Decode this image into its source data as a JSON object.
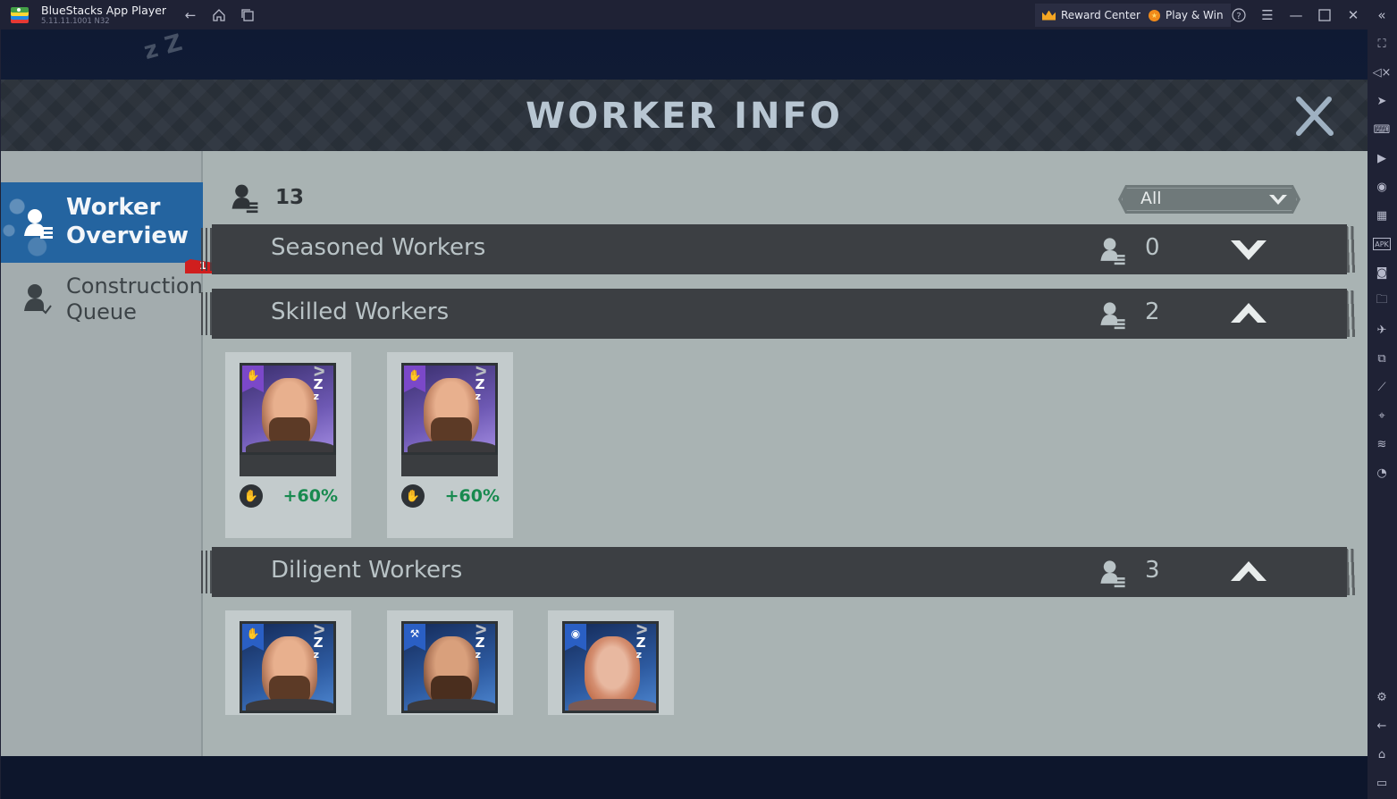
{
  "window": {
    "app_name": "BlueStacks App Player",
    "version": "5.11.11.1001 N32",
    "nav_icons": [
      "back-icon",
      "home-icon",
      "recent-apps-icon"
    ],
    "reward_center_label": "Reward Center",
    "play_win_label": "Play & Win",
    "controls": [
      "help-icon",
      "menu-icon",
      "minimize-icon",
      "maximize-icon",
      "close-icon",
      "collapse-sidebar-icon"
    ]
  },
  "right_sidebar": {
    "items": [
      {
        "name": "fullscreen",
        "glyph": "⛶"
      },
      {
        "name": "volume-mute",
        "glyph": "🔇"
      },
      {
        "name": "pointer",
        "glyph": "➤"
      },
      {
        "name": "keyboard",
        "glyph": "⌨"
      },
      {
        "name": "macro-play",
        "glyph": "▶"
      },
      {
        "name": "rotate-sync",
        "glyph": "◉"
      },
      {
        "name": "game-controls",
        "glyph": "▦"
      },
      {
        "name": "apk-install",
        "glyph": "APK"
      },
      {
        "name": "screenshot",
        "glyph": "◙"
      },
      {
        "name": "folder",
        "glyph": "🗀"
      },
      {
        "name": "airplane-mode",
        "glyph": "✈"
      },
      {
        "name": "multi-instance",
        "glyph": "⧉"
      },
      {
        "name": "shake",
        "glyph": "⟋"
      },
      {
        "name": "location",
        "glyph": "⌖"
      },
      {
        "name": "layers",
        "glyph": "≋"
      },
      {
        "name": "eco-mode",
        "glyph": "◔"
      }
    ],
    "bottom_items": [
      {
        "name": "settings",
        "glyph": "⚙"
      },
      {
        "name": "back",
        "glyph": "←"
      },
      {
        "name": "home",
        "glyph": "⌂"
      },
      {
        "name": "recent-apps",
        "glyph": "▭"
      }
    ]
  },
  "game": {
    "title": "WORKER INFO",
    "tabs": [
      {
        "label_line1": "Worker",
        "label_line2": "Overview",
        "active": true
      },
      {
        "label_line1": "Construction",
        "label_line2": "Queue",
        "active": false,
        "badge": "1"
      }
    ],
    "total_workers": "13",
    "filter": {
      "selected": "All"
    },
    "sections": [
      {
        "title": "Seasoned Workers",
        "count": "0",
        "expanded": false,
        "workers": []
      },
      {
        "title": "Skilled Workers",
        "count": "2",
        "expanded": true,
        "workers": [
          {
            "tier": "purple",
            "role": "builder-hand",
            "status": "sleeping",
            "skill_bonus": "+60%",
            "face": "brown"
          },
          {
            "tier": "purple",
            "role": "builder-hand",
            "status": "sleeping",
            "skill_bonus": "+60%",
            "face": "brown"
          }
        ]
      },
      {
        "title": "Diligent Workers",
        "count": "3",
        "expanded": true,
        "workers": [
          {
            "tier": "blue",
            "role": "builder-hand",
            "status": "sleeping",
            "face": "brown"
          },
          {
            "tier": "blue",
            "role": "hammer",
            "status": "sleeping",
            "face": "dark"
          },
          {
            "tier": "blue",
            "role": "scout-eye",
            "status": "sleeping",
            "face": "red"
          }
        ]
      }
    ],
    "colors": {
      "accent_tab": "#2464a0",
      "bonus_green": "#188a4f",
      "badge_red": "#d01e1e",
      "skilled_tier": "#7b48c9",
      "diligent_tier": "#2a5fc4"
    }
  }
}
